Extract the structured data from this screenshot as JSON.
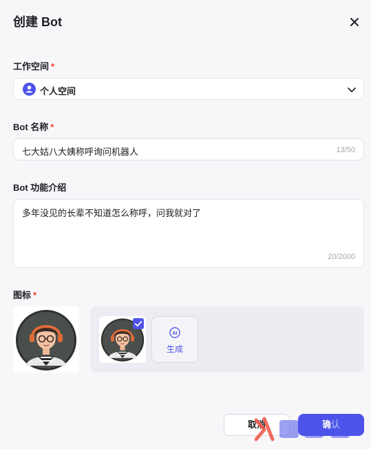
{
  "dialog": {
    "title": "创建 Bot"
  },
  "workspace": {
    "label": "工作空间",
    "required_mark": "*",
    "selected": "个人空间"
  },
  "bot_name": {
    "label": "Bot 名称",
    "required_mark": "*",
    "value": "七大姑八大姨称呼询问机器人",
    "counter": "13/50"
  },
  "bot_description": {
    "label": "Bot 功能介绍",
    "value": "多年没见的长辈不知道怎么称呼，问我就对了",
    "counter": "20/2000"
  },
  "icon": {
    "label": "图标",
    "required_mark": "*",
    "generate_label": "生成",
    "ai_badge": "AI"
  },
  "footer": {
    "cancel_label": "取消",
    "confirm_label": "确认"
  },
  "colors": {
    "accent": "#4d53e8",
    "required": "#f93920"
  }
}
